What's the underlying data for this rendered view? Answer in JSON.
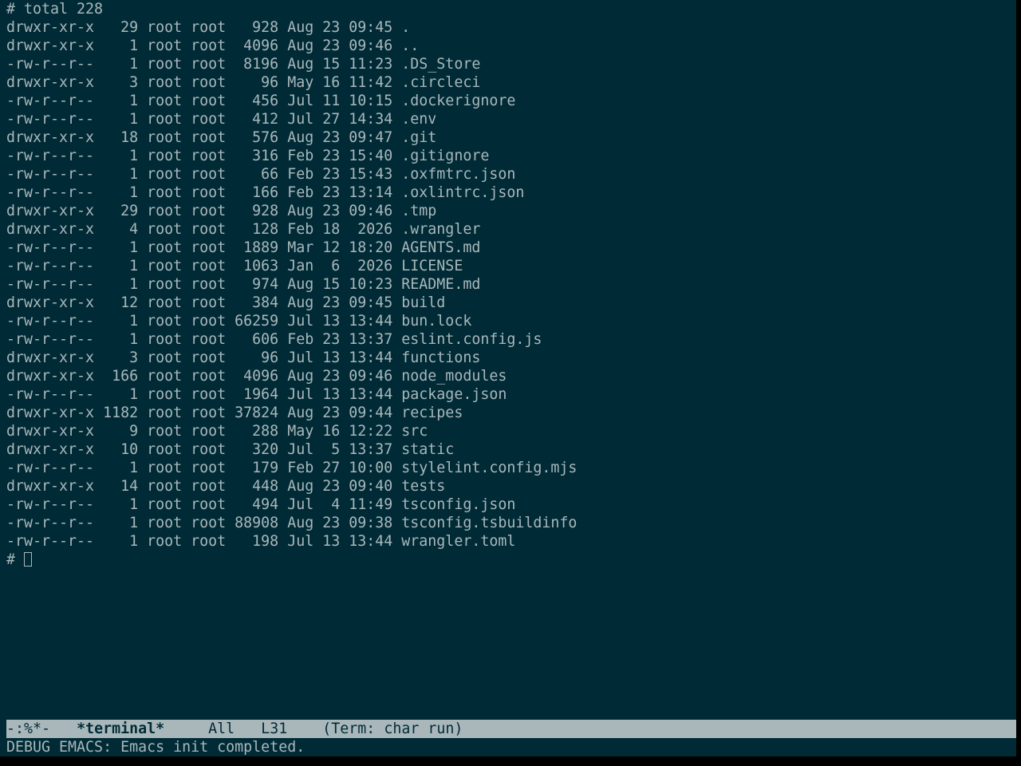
{
  "terminal": {
    "header_line": "# total 228",
    "listing": [
      "drwxr-xr-x   29 root root   928 Aug 23 09:45 .",
      "drwxr-xr-x    1 root root  4096 Aug 23 09:46 ..",
      "-rw-r--r--    1 root root  8196 Aug 15 11:23 .DS_Store",
      "drwxr-xr-x    3 root root    96 May 16 11:42 .circleci",
      "-rw-r--r--    1 root root   456 Jul 11 10:15 .dockerignore",
      "-rw-r--r--    1 root root   412 Jul 27 14:34 .env",
      "drwxr-xr-x   18 root root   576 Aug 23 09:47 .git",
      "-rw-r--r--    1 root root   316 Feb 23 15:40 .gitignore",
      "-rw-r--r--    1 root root    66 Feb 23 15:43 .oxfmtrc.json",
      "-rw-r--r--    1 root root   166 Feb 23 13:14 .oxlintrc.json",
      "drwxr-xr-x   29 root root   928 Aug 23 09:46 .tmp",
      "drwxr-xr-x    4 root root   128 Feb 18  2026 .wrangler",
      "-rw-r--r--    1 root root  1889 Mar 12 18:20 AGENTS.md",
      "-rw-r--r--    1 root root  1063 Jan  6  2026 LICENSE",
      "-rw-r--r--    1 root root   974 Aug 15 10:23 README.md",
      "drwxr-xr-x   12 root root   384 Aug 23 09:45 build",
      "-rw-r--r--    1 root root 66259 Jul 13 13:44 bun.lock",
      "-rw-r--r--    1 root root   606 Feb 23 13:37 eslint.config.js",
      "drwxr-xr-x    3 root root    96 Jul 13 13:44 functions",
      "drwxr-xr-x  166 root root  4096 Aug 23 09:46 node_modules",
      "-rw-r--r--    1 root root  1964 Jul 13 13:44 package.json",
      "drwxr-xr-x 1182 root root 37824 Aug 23 09:44 recipes",
      "drwxr-xr-x    9 root root   288 May 16 12:22 src",
      "drwxr-xr-x   10 root root   320 Jul  5 13:37 static",
      "-rw-r--r--    1 root root   179 Feb 27 10:00 stylelint.config.mjs",
      "drwxr-xr-x   14 root root   448 Aug 23 09:40 tests",
      "-rw-r--r--    1 root root   494 Jul  4 11:49 tsconfig.json",
      "-rw-r--r--    1 root root 88908 Aug 23 09:38 tsconfig.tsbuildinfo",
      "-rw-r--r--    1 root root   198 Jul 13 13:44 wrangler.toml"
    ],
    "prompt": "# "
  },
  "mode_line": {
    "status": "-:%*-",
    "buffer_name": "*terminal*",
    "position": "All",
    "line": "L31",
    "mode": "(Term: char run)"
  },
  "echo_area": {
    "message": "DEBUG EMACS: Emacs init completed."
  },
  "colors": {
    "background": "#002b36",
    "foreground": "#a9b7bb",
    "mode_line_bg": "#a9b7bb",
    "outer": "#000000"
  }
}
